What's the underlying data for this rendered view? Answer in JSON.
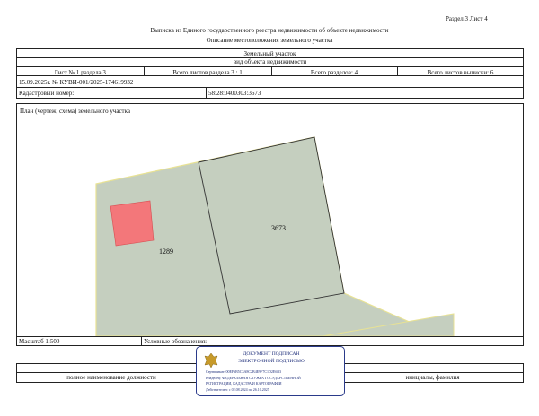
{
  "header": {
    "section_sheet": "Раздел 3   Лист 4",
    "title": "Выписка из Единого государственного реестра недвижимости об объекте недвижимости",
    "subtitle": "Описание местоположения земельного участка"
  },
  "object": {
    "type": "Земельный участок",
    "type_caption": "вид объекта недвижимости"
  },
  "sheet_info": {
    "sheet": "Лист № 1 раздела 3",
    "sheets_in_section": "Всего листов раздела 3 : 1",
    "sections_total": "Всего разделов: 4",
    "sheets_total": "Всего листов выписки: 6"
  },
  "record": {
    "number_line": "15.09.2025г. № КУВИ-001/2025-174619932",
    "cadastral_label": "Кадастровый номер:",
    "cadastral_number": "58:28:0400303:3673"
  },
  "plan": {
    "caption": "План (чертеж, схема) земельного участка",
    "parcel_left_label": "1289",
    "parcel_right_label": "3673",
    "scale_label": "Масштаб 1:500",
    "legend_label": "Условные обозначения:"
  },
  "footer": {
    "position_caption": "полное наименование должности",
    "name_caption": "инициалы, фамилия"
  },
  "stamp": {
    "line1": "ДОКУМЕНТ ПОДПИСАН",
    "line2": "ЭЛЕКТРОННОЙ ПОДПИСЬЮ",
    "cert": "Сертификат: 00ЕF6В5С3А8С2В4Е9F7С1D2Е6В3",
    "owner": "Владелец: ФЕДЕРАЛЬНАЯ СЛУЖБА ГОСУДАРСТВЕННОЙ",
    "owner2": "РЕГИСТРАЦИИ, КАДАСТРА И КАРТОГРАФИИ",
    "valid": "Действителен: с 02.08.2024 по 26.10.2025"
  },
  "colors": {
    "parcel_fill": "#c5cfbf",
    "parcel_border": "#e8e294",
    "building_fill": "#f3777a",
    "stamp_border": "#2a3a8a"
  }
}
